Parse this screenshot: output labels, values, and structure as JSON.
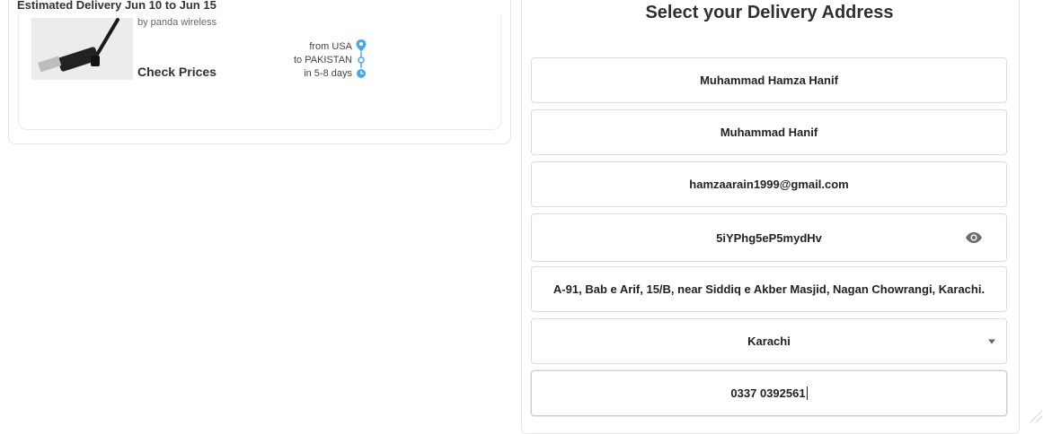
{
  "left": {
    "estimated_delivery": "Estimated Delivery Jun 10 to Jun 15",
    "product": {
      "vendor": "by panda wireless",
      "check_prices_label": "Check Prices",
      "route": {
        "from": "from USA",
        "to": "to PAKISTAN",
        "duration": "in 5-8 days"
      }
    }
  },
  "right": {
    "title": "Select your Delivery Address",
    "fields": {
      "full_name": "Muhammad Hamza Hanif",
      "father_name": "Muhammad Hanif",
      "email": "hamzaarain1999@gmail.com",
      "password": "5iYPhg5eP5mydHv",
      "address": "A-91, Bab e Arif, 15/B, near Siddiq e Akber Masjid, Nagan Chowrangi, Karachi.",
      "city": "Karachi",
      "phone": "0337 0392561"
    }
  },
  "icons": {
    "location_pin": "map-pin-icon",
    "clock": "clock-icon",
    "eye": "eye-icon",
    "dropdown": "chevron-down-icon"
  },
  "colors": {
    "accent_blue": "#4aa8e0"
  }
}
